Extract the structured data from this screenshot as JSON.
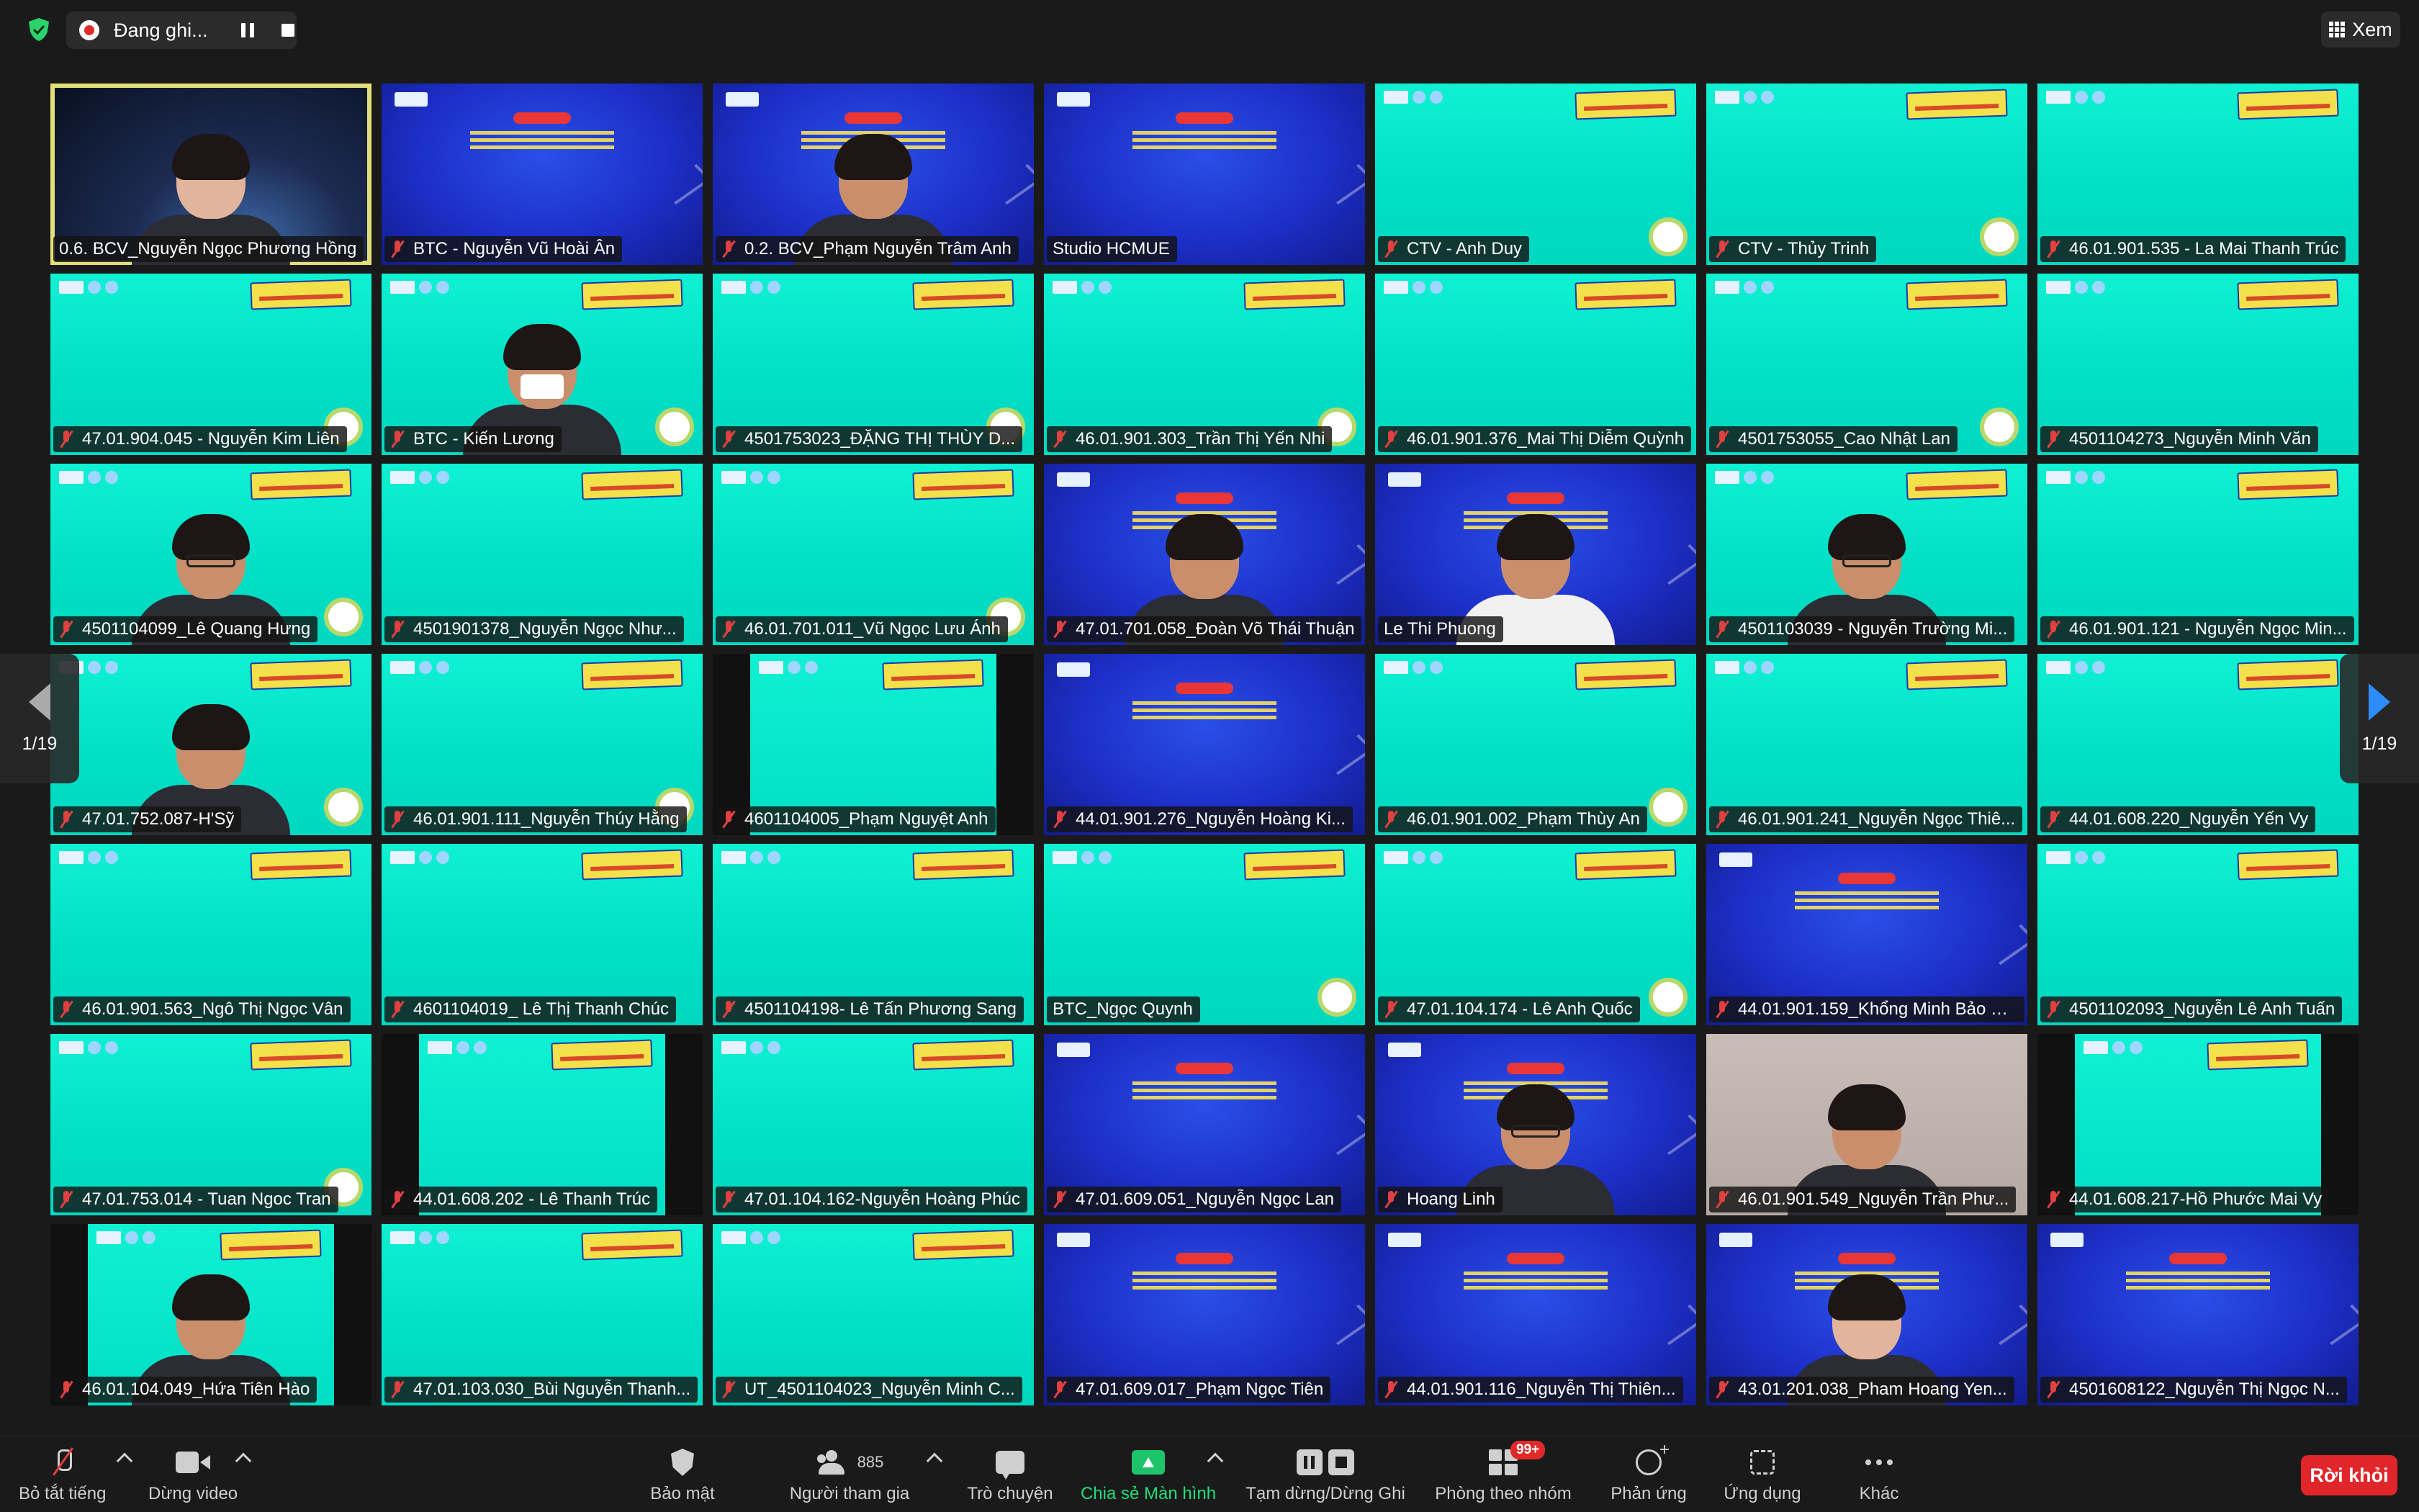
{
  "recording": {
    "label": "Đang ghi..."
  },
  "view_button": {
    "label": "Xem"
  },
  "pagination": {
    "left": "1/19",
    "right": "1/19"
  },
  "participants": [
    {
      "name": "0.6. BCV_Nguyễn Ngọc Phương Hồng",
      "bg": "space",
      "muted": false,
      "active": true,
      "person": "light"
    },
    {
      "name": "BTC - Nguyễn Vũ Hoài Ân",
      "bg": "blue",
      "muted": true
    },
    {
      "name": "0.2. BCV_Phạm Nguyễn Trâm Anh",
      "bg": "blue",
      "muted": true,
      "person": "dark"
    },
    {
      "name": "Studio HCMUE",
      "bg": "blue",
      "muted": false
    },
    {
      "name": "CTV - Anh Duy",
      "bg": "green",
      "muted": true,
      "ring": true
    },
    {
      "name": "CTV - Thủy Trinh",
      "bg": "green",
      "muted": true,
      "ring": true
    },
    {
      "name": "46.01.901.535 - La Mai Thanh Trúc",
      "bg": "green",
      "muted": true
    },
    {
      "name": "47.01.904.045 - Nguyễn Kim Liên",
      "bg": "green",
      "muted": true,
      "ring": true
    },
    {
      "name": "BTC - Kiến Lương",
      "bg": "green",
      "muted": true,
      "ring": true,
      "person": "mask"
    },
    {
      "name": "4501753023_ĐẶNG THỊ THÙY D...",
      "bg": "green",
      "muted": true,
      "ring": true
    },
    {
      "name": "46.01.901.303_Trần Thị Yến Nhi",
      "bg": "green",
      "muted": true,
      "ring": true
    },
    {
      "name": "46.01.901.376_Mai Thị Diễm Quỳnh",
      "bg": "green",
      "muted": true
    },
    {
      "name": "4501753055_Cao Nhật Lan",
      "bg": "green",
      "muted": true,
      "ring": true
    },
    {
      "name": "4501104273_Nguyễn Minh Văn",
      "bg": "green",
      "muted": true
    },
    {
      "name": "4501104099_Lê Quang Hưng",
      "bg": "green",
      "muted": true,
      "ring": true,
      "person": "glasses"
    },
    {
      "name": "4501901378_Nguyễn Ngọc Như...",
      "bg": "green",
      "muted": true
    },
    {
      "name": "46.01.701.011_Vũ Ngọc Lưu Ánh",
      "bg": "green",
      "muted": true,
      "ring": true
    },
    {
      "name": "47.01.701.058_Đoàn Võ Thái Thuận",
      "bg": "blue",
      "muted": true,
      "person": "dark"
    },
    {
      "name": "Le Thi Phuong",
      "bg": "blue",
      "muted": false,
      "person": "white"
    },
    {
      "name": "4501103039 - Nguyễn Trường Mi...",
      "bg": "green",
      "muted": true,
      "person": "glasses"
    },
    {
      "name": "46.01.901.121 - Nguyễn Ngọc Min...",
      "bg": "green",
      "muted": true
    },
    {
      "name": "47.01.752.087-H'Sỹ",
      "bg": "green",
      "muted": true,
      "ring": true,
      "person": "dark"
    },
    {
      "name": "46.01.901.111_Nguyễn Thúy Hằng",
      "bg": "green",
      "muted": true,
      "ring": true
    },
    {
      "name": "4601104005_Phạm Nguyệt Anh",
      "bg": "boxed",
      "muted": true
    },
    {
      "name": "44.01.901.276_Nguyễn Hoàng Ki...",
      "bg": "blue",
      "muted": true
    },
    {
      "name": "46.01.901.002_Phạm Thùy An",
      "bg": "green",
      "muted": true,
      "ring": true
    },
    {
      "name": "46.01.901.241_Nguyễn Ngọc Thiê...",
      "bg": "green",
      "muted": true
    },
    {
      "name": "44.01.608.220_Nguyễn Yến Vy",
      "bg": "green",
      "muted": true
    },
    {
      "name": "46.01.901.563_Ngô Thị Ngọc Vân",
      "bg": "green",
      "muted": true
    },
    {
      "name": "4601104019_ Lê Thị Thanh Chúc",
      "bg": "green",
      "muted": true
    },
    {
      "name": "4501104198- Lê Tấn Phương Sang",
      "bg": "green",
      "muted": true
    },
    {
      "name": "BTC_Ngọc Quynh",
      "bg": "green",
      "muted": false,
      "ring": true
    },
    {
      "name": "47.01.104.174 - Lê Anh Quốc",
      "bg": "green",
      "muted": true,
      "ring": true
    },
    {
      "name": "44.01.901.159_Khổng Minh Bảo N...",
      "bg": "blue",
      "muted": true
    },
    {
      "name": "4501102093_Nguyễn Lê Anh Tuấn",
      "bg": "green",
      "muted": true
    },
    {
      "name": "47.01.753.014 - Tuan Ngoc Tran",
      "bg": "green",
      "muted": true,
      "ring": true
    },
    {
      "name": "44.01.608.202 - Lê Thanh Trúc",
      "bg": "boxed",
      "muted": true
    },
    {
      "name": "47.01.104.162-Nguyễn Hoàng Phúc",
      "bg": "green",
      "muted": true
    },
    {
      "name": "47.01.609.051_Nguyễn Ngọc Lan",
      "bg": "blue",
      "muted": true
    },
    {
      "name": "Hoang Linh",
      "bg": "blue",
      "muted": true,
      "person": "glasses"
    },
    {
      "name": "46.01.901.549_Nguyễn Trần Phư...",
      "bg": "room",
      "muted": true,
      "person": "dark"
    },
    {
      "name": "44.01.608.217-Hồ Phước Mai Vy",
      "bg": "boxed",
      "muted": true
    },
    {
      "name": "46.01.104.049_Hứa Tiên Hào",
      "bg": "boxed",
      "muted": true,
      "person": "dark"
    },
    {
      "name": "47.01.103.030_Bùi Nguyễn Thanh...",
      "bg": "green",
      "muted": true
    },
    {
      "name": "UT_4501104023_Nguyễn Minh C...",
      "bg": "green",
      "muted": true
    },
    {
      "name": "47.01.609.017_Phạm Ngọc Tiên",
      "bg": "blue",
      "muted": true
    },
    {
      "name": "44.01.901.116_Nguyễn Thị Thiên...",
      "bg": "blue",
      "muted": true
    },
    {
      "name": "43.01.201.038_Pham Hoang Yen...",
      "bg": "blue",
      "muted": true,
      "person": "light"
    },
    {
      "name": "4501608122_Nguyễn Thị Ngọc N...",
      "bg": "blue",
      "muted": true
    }
  ],
  "toolbar": {
    "mute": "Bỏ tắt tiếng",
    "video": "Dừng video",
    "security": "Bảo mật",
    "participants": "Người tham gia",
    "participant_count": "885",
    "chat": "Trò chuyện",
    "share": "Chia sẻ Màn hình",
    "pause_stop": "Tạm dừng/Dừng Ghi",
    "rooms": "Phòng theo nhóm",
    "rooms_badge": "99+",
    "reactions": "Phản ứng",
    "apps": "Ứng dụng",
    "more": "Khác",
    "leave": "Rời khỏi"
  }
}
